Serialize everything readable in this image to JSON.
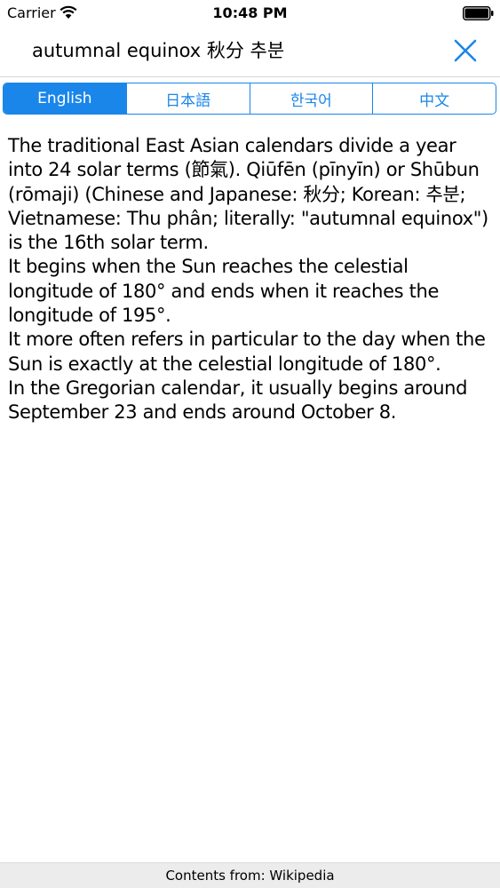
{
  "status_bar": {
    "carrier": "Carrier",
    "time": "10:48 PM",
    "wifi_icon": "wifi-icon",
    "battery_icon": "battery-icon"
  },
  "nav": {
    "title": "autumnal equinox 秋分 추분",
    "close_icon": "close-icon"
  },
  "tabs": [
    {
      "label": "English",
      "active": true
    },
    {
      "label": "日本語",
      "active": false
    },
    {
      "label": "한국어",
      "active": false
    },
    {
      "label": "中文",
      "active": false
    }
  ],
  "article": {
    "paragraphs": [
      "The traditional East Asian calendars divide a year into 24 solar terms (節氣). Qiūfēn (pīnyīn) or Shūbun (rōmaji) (Chinese and Japanese: 秋分; Korean: 추분; Vietnamese: Thu phân; literally: \"autumnal equinox\") is the 16th solar term.",
      "It begins when the Sun reaches the celestial longitude of 180° and ends when it reaches the longitude of 195°.",
      "It more often refers in particular to the day when the Sun is exactly at the celestial longitude of 180°.",
      "In the Gregorian calendar, it usually begins around September 23 and ends around October 8."
    ]
  },
  "footer": {
    "text": "Contents from: Wikipedia"
  },
  "colors": {
    "accent": "#1a86e9"
  }
}
